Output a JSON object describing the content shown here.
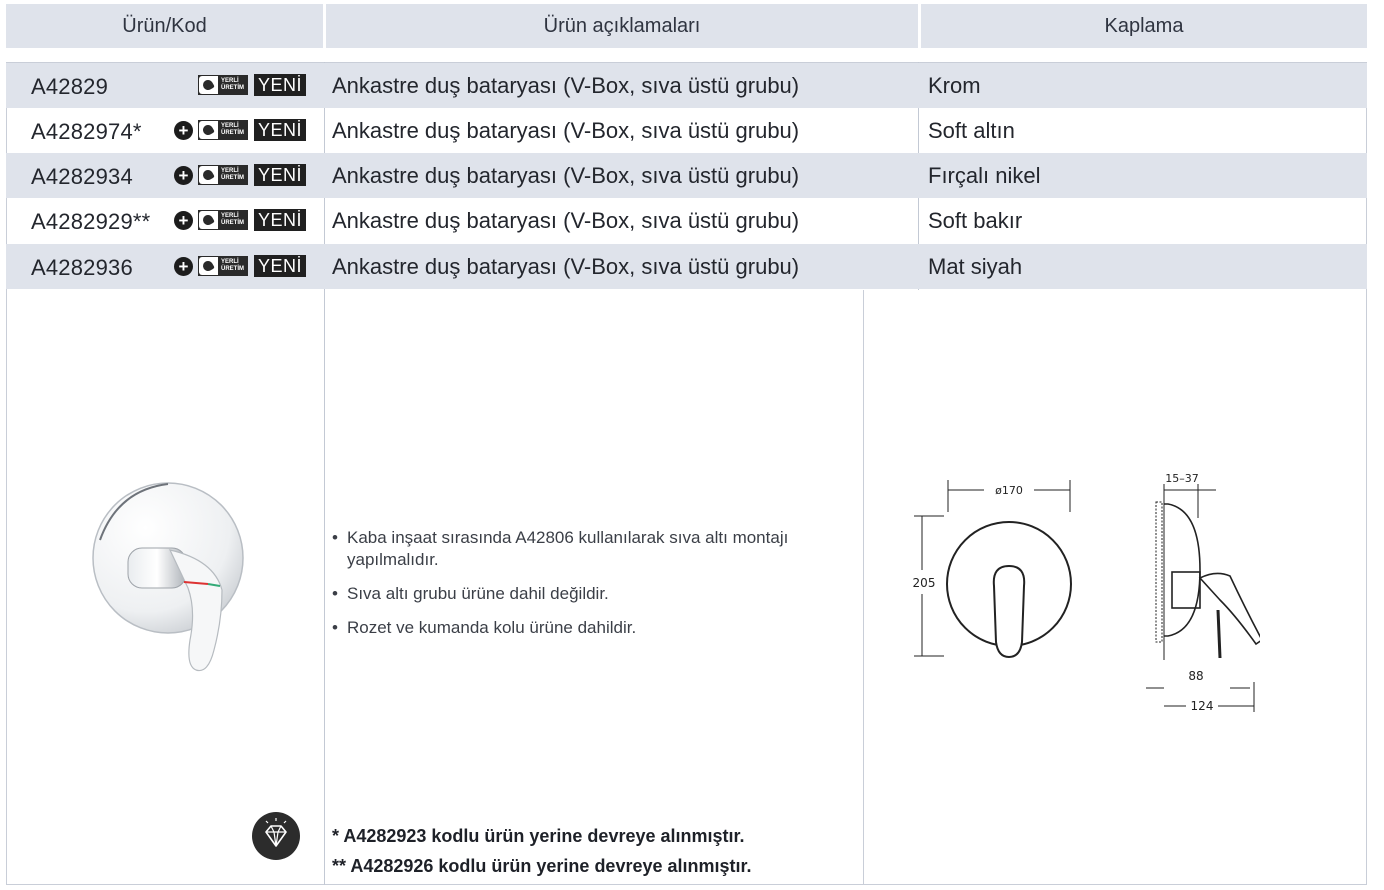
{
  "header": {
    "code_col": "Ürün/Kod",
    "desc_col": "Ürün açıklamaları",
    "finish_col": "Kaplama"
  },
  "badges": {
    "plus_symbol": "+",
    "local_line1": "YERLİ",
    "local_line2": "ÜRETİM",
    "new_label": "YENİ"
  },
  "rows": [
    {
      "code": "A42829",
      "description": "Ankastre duş bataryası (V-Box, sıva üstü grubu)",
      "finish": "Krom"
    },
    {
      "code": "A4282974*",
      "description": "Ankastre duş bataryası (V-Box, sıva üstü grubu)",
      "finish": "Soft altın"
    },
    {
      "code": "A4282934",
      "description": "Ankastre duş bataryası (V-Box, sıva üstü grubu)",
      "finish": "Fırçalı nikel"
    },
    {
      "code": "A4282929**",
      "description": "Ankastre duş bataryası (V-Box, sıva üstü grubu)",
      "finish": "Soft bakır"
    },
    {
      "code": "A4282936",
      "description": "Ankastre duş bataryası (V-Box, sıva üstü grubu)",
      "finish": "Mat siyah"
    }
  ],
  "info": {
    "bullets": [
      "Kaba inşaat sırasında A42806 kullanılarak sıva altı montajı yapılmalıdır.",
      "Sıva altı grubu ürüne dahil değildir.",
      "Rozet ve kumanda kolu ürüne dahildir."
    ],
    "note1": "* A4282923 kodlu ürün yerine devreye alınmıştır.",
    "note2": "** A4282926 kodlu ürün yerine devreye alınmıştır."
  },
  "drawing": {
    "diameter": "ø170",
    "height": "205",
    "depth_range": "15–37",
    "dim_88": "88",
    "dim_124": "124"
  },
  "icons": {
    "premium": "diamond-icon",
    "product": "shower-mixer-photo"
  },
  "colors": {
    "header_bg": "#dfe3eb",
    "row_shade": "#dfe3eb",
    "badge_dark": "#202020"
  }
}
